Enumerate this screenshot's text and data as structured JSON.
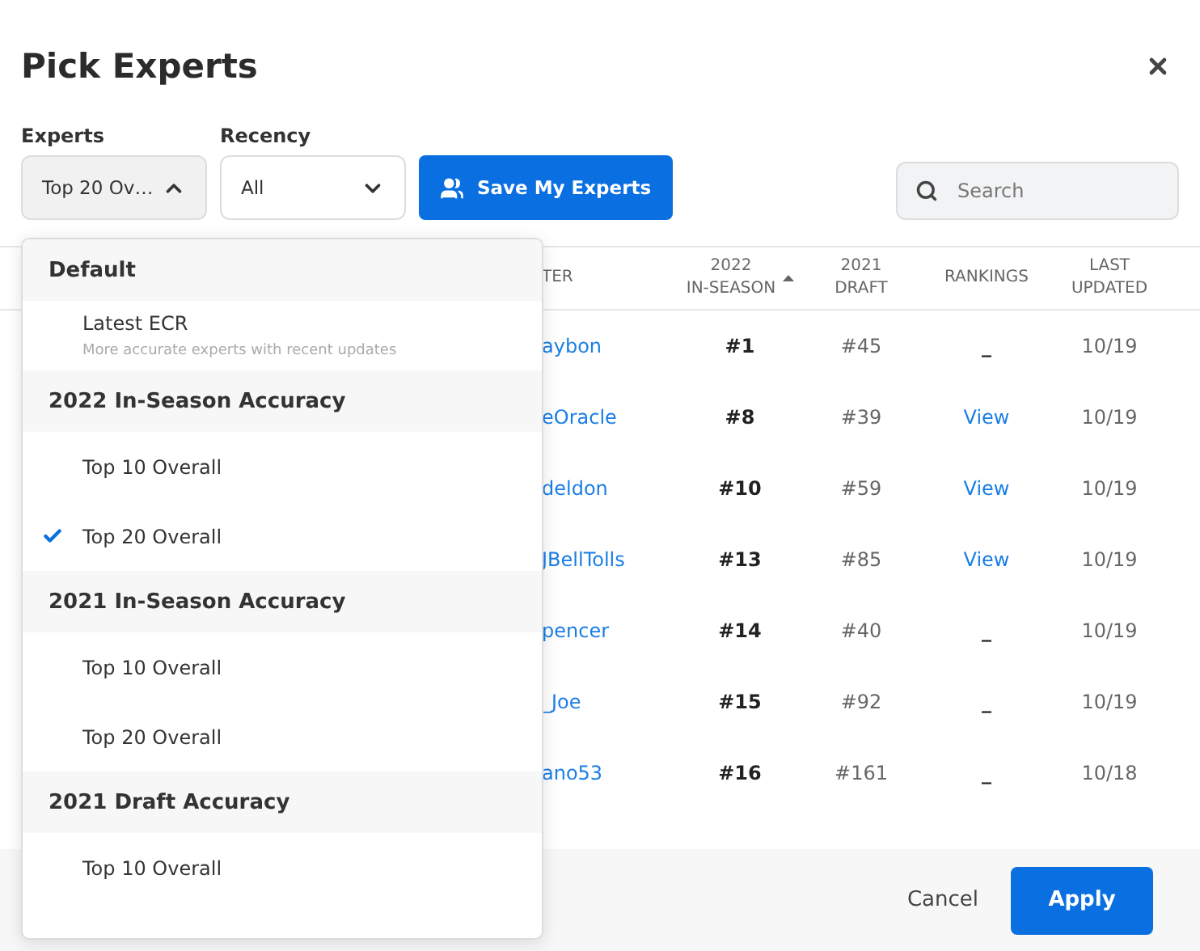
{
  "title": "Pick Experts",
  "filters": [
    {
      "label": "Experts",
      "value": "Top 20 Ov…",
      "expanded": true
    },
    {
      "label": "Recency",
      "value": "All",
      "expanded": false
    }
  ],
  "save_button": "Save My Experts",
  "search": {
    "placeholder": "Search"
  },
  "dropdown": [
    {
      "heading": "Default",
      "options": [
        {
          "label": "Latest ECR",
          "description": "More accurate experts with recent updates",
          "selected": false
        }
      ]
    },
    {
      "heading": "2022 In-Season Accuracy",
      "options": [
        {
          "label": "Top 10 Overall",
          "selected": false
        },
        {
          "label": "Top 20 Overall",
          "selected": true
        }
      ]
    },
    {
      "heading": "2021 In-Season Accuracy",
      "options": [
        {
          "label": "Top 10 Overall",
          "selected": false
        },
        {
          "label": "Top 20 Overall",
          "selected": false
        }
      ]
    },
    {
      "heading": "2021 Draft Accuracy",
      "options": [
        {
          "label": "Top 10 Overall",
          "selected": false
        }
      ]
    }
  ],
  "table": {
    "columns": [
      {
        "label": "TER",
        "sorted": false
      },
      {
        "label": "2022\nIN-SEASON",
        "sorted": true
      },
      {
        "label": "2021\nDRAFT",
        "sorted": false
      },
      {
        "label": "RANKINGS",
        "sorted": false
      },
      {
        "label": "LAST\nUPDATED",
        "sorted": false
      }
    ],
    "rows": [
      {
        "expert": "aybon",
        "in_season": "#1",
        "draft": "#45",
        "rankings": {
          "text": "_",
          "link": false
        },
        "updated": "10/19"
      },
      {
        "expert": "eOracle",
        "in_season": "#8",
        "draft": "#39",
        "rankings": {
          "text": "View",
          "link": true
        },
        "updated": "10/19"
      },
      {
        "expert": "deldon",
        "in_season": "#10",
        "draft": "#59",
        "rankings": {
          "text": "View",
          "link": true
        },
        "updated": "10/19"
      },
      {
        "expert": "JBellTolls",
        "in_season": "#13",
        "draft": "#85",
        "rankings": {
          "text": "View",
          "link": true
        },
        "updated": "10/19"
      },
      {
        "expert": "pencer",
        "in_season": "#14",
        "draft": "#40",
        "rankings": {
          "text": "_",
          "link": false
        },
        "updated": "10/19"
      },
      {
        "expert": "_Joe",
        "in_season": "#15",
        "draft": "#92",
        "rankings": {
          "text": "_",
          "link": false
        },
        "updated": "10/19"
      },
      {
        "expert": "ano53",
        "in_season": "#16",
        "draft": "#161",
        "rankings": {
          "text": "_",
          "link": false
        },
        "updated": "10/18"
      }
    ]
  },
  "footer": {
    "cancel": "Cancel",
    "apply": "Apply"
  }
}
